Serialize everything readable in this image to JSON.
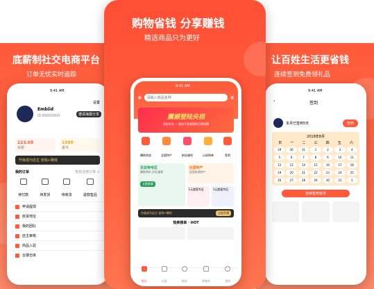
{
  "left": {
    "title": "底薪制社交电商平台",
    "subtitle": "订单无忧实时追踪",
    "status_time": "9:41 AM",
    "settings": "设置",
    "profile": {
      "name": "Embiid",
      "id": "ID:80000000",
      "badge": "邀请海报分享"
    },
    "stats": [
      {
        "value": "223.08",
        "label": "余额"
      },
      {
        "value": "1988",
        "label": "金币"
      }
    ],
    "promo": "升级成为店主 省钱+赚钱",
    "my_orders": "我的订单",
    "view_all": "查看全部订单 >",
    "order_tabs": [
      "待付款",
      "待发货",
      "待收货",
      "退款售后"
    ],
    "menu": [
      "申请提现",
      "收货地址",
      "我的团队",
      "店主审核",
      "商品入驻",
      "云端仓库"
    ]
  },
  "center": {
    "title": "购物省钱 分享赚钱",
    "subtitle": "精选商品只为更好",
    "status_time": "9:41 AM",
    "search_placeholder": "请输入商品名称",
    "banner": {
      "title": "震撼登陆央视",
      "sub": "货好价优 — 服务千家星期的日常消费"
    },
    "icons": [
      "爆款热卖",
      "全国特产",
      "粉丝福利",
      "以采购单",
      "签到"
    ],
    "zone1": {
      "title": "百货特专区",
      "sub": "爆款特价 好礼推荐",
      "btn": "立即查看"
    },
    "zone2": {
      "title": "全国特产",
      "sub": "全国各地特产"
    },
    "zone3": "1元超值专区",
    "zone4": "1元超值专区",
    "promo": "升级成为店主 省钱+赚钱",
    "promo_btn": "立即开通",
    "hot": "热卖榜单 · HOT",
    "tabs": [
      "首页",
      "分类",
      "粉丝",
      "购物车",
      "我的"
    ]
  },
  "right": {
    "title": "让百姓生活更省钱",
    "subtitle": "连续签到免费领礼品",
    "status_time": "9:41 AM",
    "header": "签到",
    "month_label": "本月已签到5天",
    "sign_btn": "签到",
    "month": "2018年8月",
    "weekdays": [
      "日",
      "一",
      "二",
      "三",
      "四",
      "五",
      "六"
    ],
    "days": [
      "29",
      "30",
      "31",
      "1",
      "2",
      "3",
      "4",
      "5",
      "6",
      "7",
      "8",
      "9",
      "10",
      "11",
      "12",
      "13",
      "14",
      "15",
      "16",
      "17",
      "18",
      "19",
      "20",
      "21",
      "22",
      "23",
      "24",
      "25",
      "26",
      "27",
      "28",
      "29",
      "30",
      "31",
      "1"
    ],
    "gifts_title": "连续签到有奖"
  },
  "colors": {
    "brand": "#ff5a3a",
    "gold": "#f5a623"
  }
}
